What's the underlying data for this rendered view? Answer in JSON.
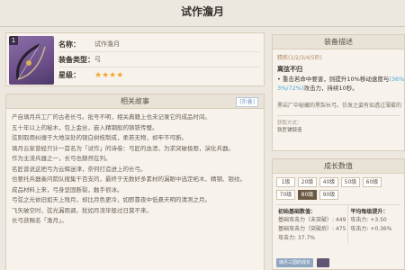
{
  "page": {
    "title": "试作澹月"
  },
  "card": {
    "badge": "1",
    "rows": [
      {
        "key": "名称：",
        "value": "试作澹月"
      },
      {
        "key": "装备类型：",
        "value": "弓"
      },
      {
        "key": "星级：",
        "value": "★★★★"
      }
    ]
  },
  "story": {
    "header": "相关故事",
    "fold_label": "[折叠]",
    "lines": [
      "产自璃月兵工厂的古老长弓。批号不明，相关典籍上也未记录它的成品时间。",
      "五十年以上的秘木，包上金丝，嵌入精钢般的铸铁传璧。",
      "弦则取用纠缠于大地深处的银白树枝制成，柔若无物，却牢不可断。",
      "璃月云家曾经只计一首名为「试作」的诗卷：弓匠的血渍，为求突破极限，演化兵器。",
      "作为主流兵器之一，长弓也赫然在列。",
      "名匠曾说这把弓为云辉迷津，奈何打造进上的长弓。",
      "也要托兵器奏问箭队搜集干百支的，最终于无数好多素材的漏眼中选定柘木、精钢、银纹。",
      "成品材料上来，弓身坚固断裂，触手很冰。",
      "弓弦之光依旧如天上残月，却比月色更冷，如即靠夜中低悬天明的清冽之月。",
      "飞矢破空时，弦光漏雨调，犹如月流毕般过日莫不来。",
      "长弓获赐名「澹月」。"
    ]
  },
  "effect": {
    "header": "装备描述",
    "refine_line": "精炼(1/2/3/4/5阶)",
    "name": "离弦不归",
    "desc_line1_prefix": "• 重击若命中要害，则提升10%移动速度与",
    "desc_line1_highlight": "(36%/45",
    "desc_line2_highlight": "3%/72%)",
    "desc_line2_suffix": "攻击力，持续10秒。",
    "note": "黑岩厂中秘藏的黑梨长弓。仿发之姿有如透过薄雾的",
    "source_label": "获取方式：",
    "source_value": "铁匠铺锻造"
  },
  "growth": {
    "header": "成长数值",
    "levels": [
      "1级",
      "20级",
      "40级",
      "50级",
      "60级",
      "70级",
      "80级",
      "90级"
    ],
    "active_level": "80级",
    "base_col": {
      "header": "初始基础数值：",
      "rows": [
        "基础攻击力（未突破）: 449",
        "基础攻击力（突破后）: 475",
        "攻击力: 37.7%"
      ]
    },
    "avg_col": {
      "header": "平均每级提升：",
      "rows": [
        "攻击力: +3.50",
        "攻击力: +0.36%"
      ]
    },
    "thumb_label": "璃月三国的成长"
  }
}
